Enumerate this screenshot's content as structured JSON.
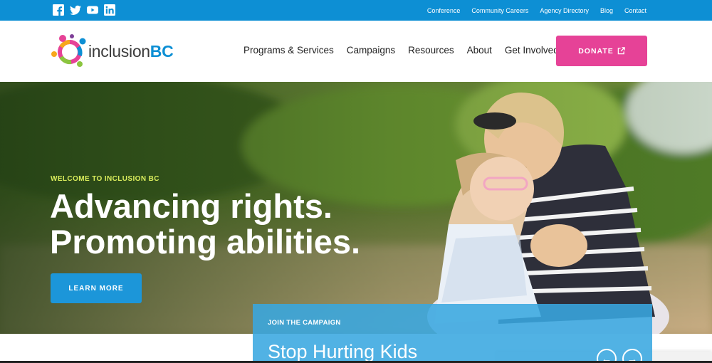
{
  "social": {
    "icons": [
      "facebook-icon",
      "twitter-icon",
      "youtube-icon",
      "linkedin-icon"
    ]
  },
  "utility_nav": {
    "links": [
      "Conference",
      "Community Careers",
      "Agency Directory",
      "Blog",
      "Contact"
    ]
  },
  "logo": {
    "text_main": "inclusion",
    "text_bc": "BC"
  },
  "main_nav": {
    "items": [
      "Programs & Services",
      "Campaigns",
      "Resources",
      "About",
      "Get Involved"
    ]
  },
  "donate": {
    "label": "DONATE"
  },
  "hero": {
    "kicker": "WELCOME TO INCLUSION BC",
    "headline_line1": "Advancing rights.",
    "headline_line2": "Promoting abilities.",
    "cta_label": "LEARN MORE"
  },
  "campaign": {
    "kicker": "JOIN THE CAMPAIGN",
    "title": "Stop Hurting Kids"
  },
  "colors": {
    "topbar": "#0d8fd4",
    "donate": "#e64297",
    "cta": "#1c96d9",
    "kicker": "#d9ec5c"
  }
}
